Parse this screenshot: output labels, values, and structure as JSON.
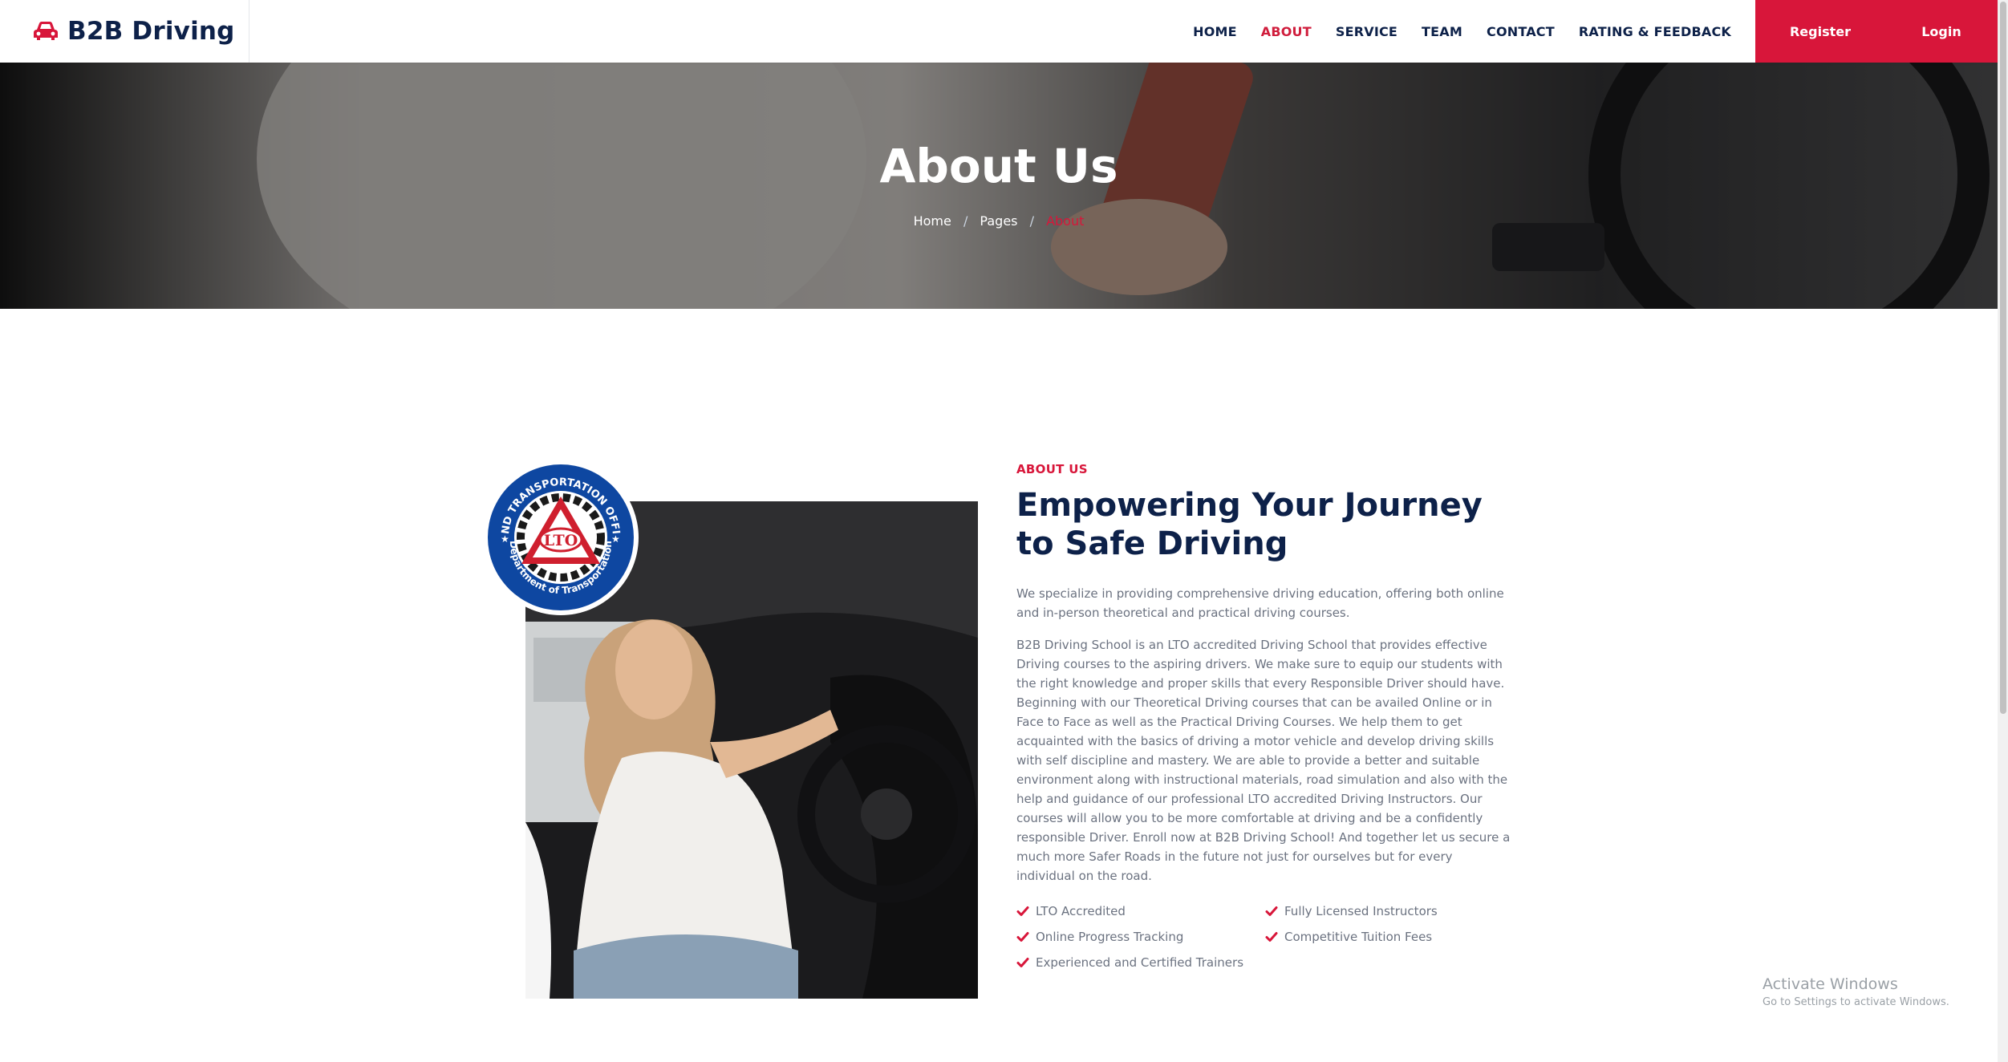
{
  "brand": {
    "name": "B2B Driving",
    "icon": "car-icon"
  },
  "nav": {
    "items": [
      {
        "label": "HOME",
        "active": false
      },
      {
        "label": "ABOUT",
        "active": true
      },
      {
        "label": "SERVICE",
        "active": false
      },
      {
        "label": "TEAM",
        "active": false
      },
      {
        "label": "CONTACT",
        "active": false
      },
      {
        "label": "RATING & FEEDBACK",
        "active": false
      }
    ],
    "register_label": "Register",
    "login_label": "Login"
  },
  "hero": {
    "title": "About Us",
    "breadcrumb": {
      "home": "Home",
      "pages": "Pages",
      "current": "About"
    }
  },
  "about": {
    "eyebrow": "ABOUT US",
    "headline": "Empowering Your Journey to Safe Driving",
    "intro": "We specialize in providing comprehensive driving education, offering both online and in-person theoretical and practical driving courses.",
    "body": "B2B Driving School is an LTO accredited Driving School that provides effective Driving courses to the aspiring drivers. We make sure to equip our students with the right knowledge and proper skills that every Responsible Driver should have. Beginning with our Theoretical Driving courses that can be availed Online or in Face to Face as well as the Practical Driving Courses. We help them to get acquainted with the basics of driving a motor vehicle and develop driving skills with self discipline and mastery. We are able to provide a better and suitable environment along with instructional materials, road simulation and also with the help and guidance of our professional LTO accredited Driving Instructors. Our courses will allow you to be more comfortable at driving and be a confidently responsible Driver. Enroll now at B2B Driving School! And together let us secure a much more Safer Roads in the future not just for ourselves but for every individual on the road.",
    "features": [
      "LTO Accredited",
      "Fully Licensed Instructors",
      "Online Progress Tracking",
      "Competitive Tuition Fees",
      "Experienced and Certified Trainers"
    ]
  },
  "logo": {
    "ring_top": "LAND TRANSPORTATION OFFICE",
    "ring_bottom": "Department of Transportation",
    "center": "LTO"
  },
  "watermark": {
    "title": "Activate Windows",
    "subtitle": "Go to Settings to activate Windows."
  },
  "colors": {
    "accent": "#d8163a",
    "navy": "#0d2149",
    "text": "#6b7280"
  }
}
